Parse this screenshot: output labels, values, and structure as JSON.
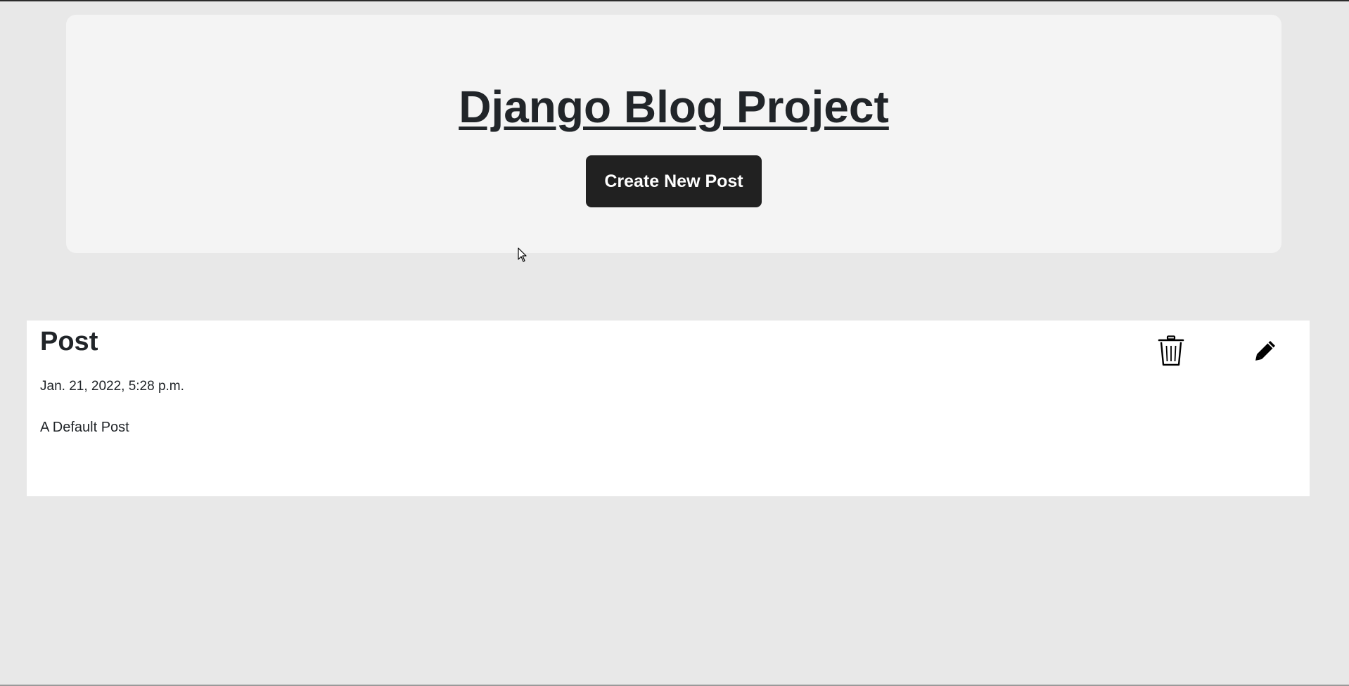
{
  "header": {
    "title": "Django Blog Project",
    "create_button_label": "Create New Post"
  },
  "posts": [
    {
      "title": "Post",
      "date": "Jan. 21, 2022, 5:28 p.m.",
      "body": "A Default Post",
      "delete_icon": "trash-icon",
      "edit_icon": "pencil-icon"
    }
  ],
  "colors": {
    "page_background": "#e8e8e8",
    "header_background": "#f4f4f4",
    "button_background": "#212121",
    "button_text": "#ffffff",
    "text": "#212529",
    "card_background": "#ffffff"
  }
}
